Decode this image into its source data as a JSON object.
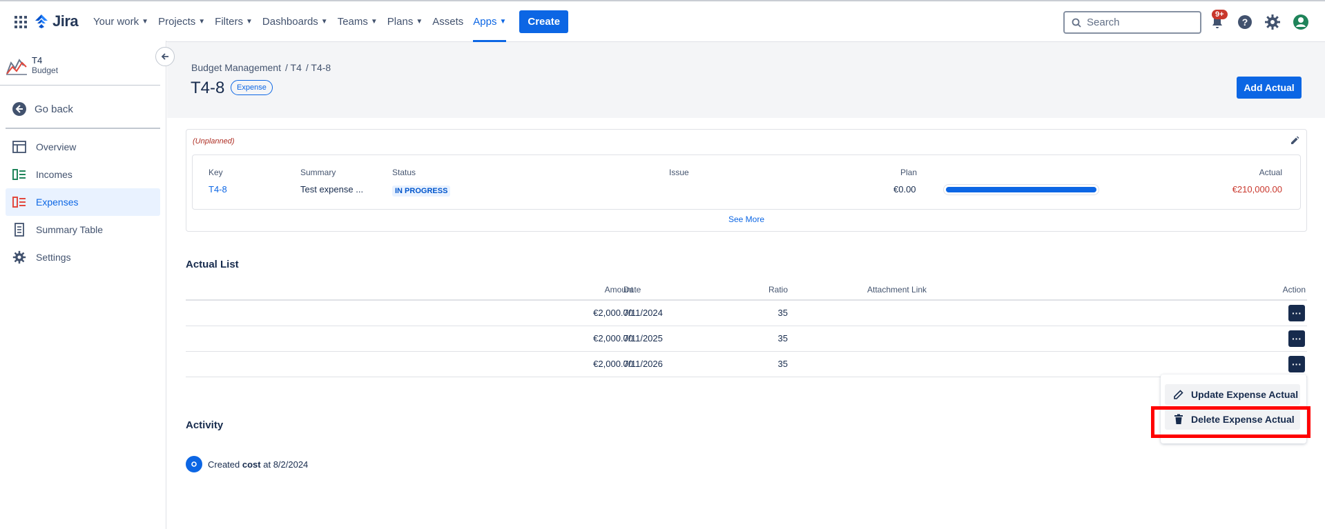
{
  "topnav": {
    "logo": "Jira",
    "items": [
      {
        "label": "Your work",
        "chevron": true
      },
      {
        "label": "Projects",
        "chevron": true
      },
      {
        "label": "Filters",
        "chevron": true
      },
      {
        "label": "Dashboards",
        "chevron": true
      },
      {
        "label": "Teams",
        "chevron": true
      },
      {
        "label": "Plans",
        "chevron": true
      },
      {
        "label": "Assets",
        "chevron": false
      },
      {
        "label": "Apps",
        "chevron": true
      }
    ],
    "create_label": "Create",
    "search_placeholder": "Search",
    "notifications_badge": "9+"
  },
  "sidebar": {
    "project_name": "T4",
    "project_sub": "Budget",
    "go_back": "Go back",
    "items": [
      {
        "label": "Overview",
        "icon": "overview-icon"
      },
      {
        "label": "Incomes",
        "icon": "incomes-icon"
      },
      {
        "label": "Expenses",
        "icon": "expenses-icon",
        "active": true
      },
      {
        "label": "Summary Table",
        "icon": "summary-table-icon"
      },
      {
        "label": "Settings",
        "icon": "gear-icon"
      }
    ]
  },
  "header": {
    "breadcrumb": [
      "Budget Management",
      "/ T4",
      "/ T4-8"
    ],
    "title": "T4-8",
    "type_lozenge": "Expense",
    "add_actual_label": "Add Actual"
  },
  "summary_card": {
    "tag": "(Unplanned)",
    "headers": {
      "key": "Key",
      "summary": "Summary",
      "status": "Status",
      "issue": "Issue",
      "plan": "Plan",
      "actual": "Actual"
    },
    "row": {
      "key": "T4-8",
      "summary": "Test expense ...",
      "status": "IN PROGRESS",
      "issue": "",
      "plan": "€0.00",
      "actual": "€210,000.00"
    },
    "progress_fraction": 1.0,
    "see_more": "See More"
  },
  "actual_list": {
    "title": "Actual List",
    "headers": {
      "amount": "Amount",
      "ratio": "Ratio",
      "date": "Date",
      "attachment": "Attachment Link",
      "action": "Action"
    },
    "rows": [
      {
        "amount": "€2,000.00",
        "ratio": "35",
        "date": "7/11/2024",
        "attachment": ""
      },
      {
        "amount": "€2,000.00",
        "ratio": "35",
        "date": "7/11/2025",
        "attachment": ""
      },
      {
        "amount": "€2,000.00",
        "ratio": "35",
        "date": "7/11/2026",
        "attachment": ""
      }
    ]
  },
  "action_menu": {
    "update_label": "Update Expense Actual",
    "delete_label": "Delete Expense Actual"
  },
  "activity": {
    "title": "Activity",
    "entry_prefix": "Created",
    "entry_bold": "cost",
    "entry_suffix": "at 8/2/2024"
  },
  "colors": {
    "brand_blue": "#0c66e4",
    "danger_red": "#c9372c",
    "highlight_red": "#ff0000",
    "dark_navy": "#172b4d"
  }
}
